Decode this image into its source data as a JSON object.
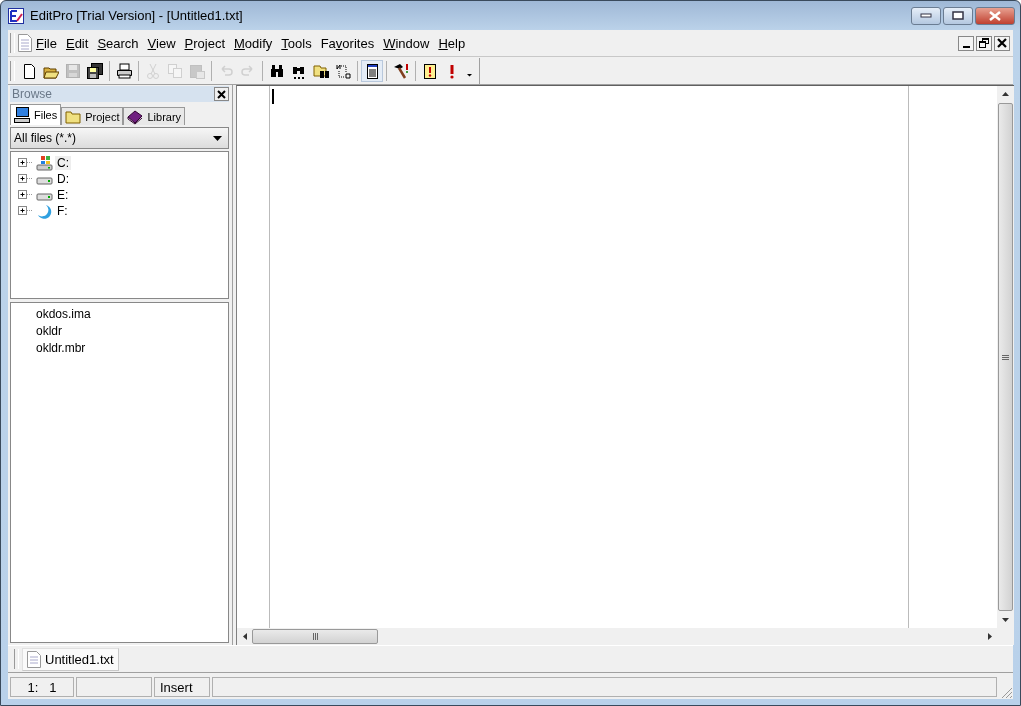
{
  "window": {
    "title": "EditPro [Trial Version] - [Untitled1.txt]"
  },
  "menu": [
    {
      "label": "File",
      "first_letter_underlined": true,
      "third_letter_underlined": false
    },
    {
      "label": "Edit",
      "first_letter_underlined": true,
      "third_letter_underlined": false
    },
    {
      "label": "Search",
      "first_letter_underlined": true,
      "third_letter_underlined": false
    },
    {
      "label": "View",
      "first_letter_underlined": true,
      "third_letter_underlined": false
    },
    {
      "label": "Project",
      "first_letter_underlined": true,
      "third_letter_underlined": false
    },
    {
      "label": "Modify",
      "first_letter_underlined": true,
      "third_letter_underlined": false
    },
    {
      "label": "Tools",
      "first_letter_underlined": true,
      "third_letter_underlined": false
    },
    {
      "label": "Favorites",
      "first_letter_underlined": false,
      "third_letter_underlined": true
    },
    {
      "label": "Window",
      "first_letter_underlined": true,
      "third_letter_underlined": false
    },
    {
      "label": "Help",
      "first_letter_underlined": true,
      "third_letter_underlined": false
    }
  ],
  "toolbar": [
    {
      "kind": "new",
      "disabled": false
    },
    {
      "kind": "open",
      "disabled": false
    },
    {
      "kind": "save",
      "disabled": true
    },
    {
      "kind": "saveall",
      "disabled": false
    },
    {
      "kind": "sep"
    },
    {
      "kind": "print",
      "disabled": false
    },
    {
      "kind": "sep"
    },
    {
      "kind": "cut",
      "disabled": true
    },
    {
      "kind": "copy",
      "disabled": true
    },
    {
      "kind": "paste",
      "disabled": true
    },
    {
      "kind": "sep"
    },
    {
      "kind": "undo",
      "disabled": true
    },
    {
      "kind": "redo",
      "disabled": true
    },
    {
      "kind": "sep"
    },
    {
      "kind": "find",
      "disabled": false
    },
    {
      "kind": "findnext",
      "disabled": false
    },
    {
      "kind": "findfiles",
      "disabled": false
    },
    {
      "kind": "replace",
      "disabled": false
    },
    {
      "kind": "sep"
    },
    {
      "kind": "doc",
      "disabled": false,
      "selected": true
    },
    {
      "kind": "sep"
    },
    {
      "kind": "tools",
      "disabled": false
    },
    {
      "kind": "sep"
    },
    {
      "kind": "mark",
      "disabled": false
    },
    {
      "kind": "alert",
      "disabled": false
    },
    {
      "kind": "more",
      "disabled": false
    }
  ],
  "browse": {
    "title": "Browse",
    "tabs": [
      {
        "label": "Files",
        "kind": "computer",
        "selected": true
      },
      {
        "label": "Project",
        "kind": "folder",
        "selected": false
      },
      {
        "label": "Library",
        "kind": "book",
        "selected": false
      }
    ],
    "filter": {
      "value": "All files (*.*)"
    },
    "drives": [
      {
        "label": "C:",
        "kind": "system",
        "selected": true
      },
      {
        "label": "D:",
        "kind": "disk",
        "selected": false
      },
      {
        "label": "E:",
        "kind": "disk",
        "selected": false
      },
      {
        "label": "F:",
        "kind": "optical",
        "selected": false
      }
    ],
    "files": [
      "okdos.ima",
      "okldr",
      "okldr.mbr"
    ]
  },
  "editor": {
    "document_tabs": [
      {
        "label": "Untitled1.txt",
        "selected": true
      }
    ]
  },
  "status_bar": {
    "position": "1:   1",
    "mode": "Insert"
  }
}
